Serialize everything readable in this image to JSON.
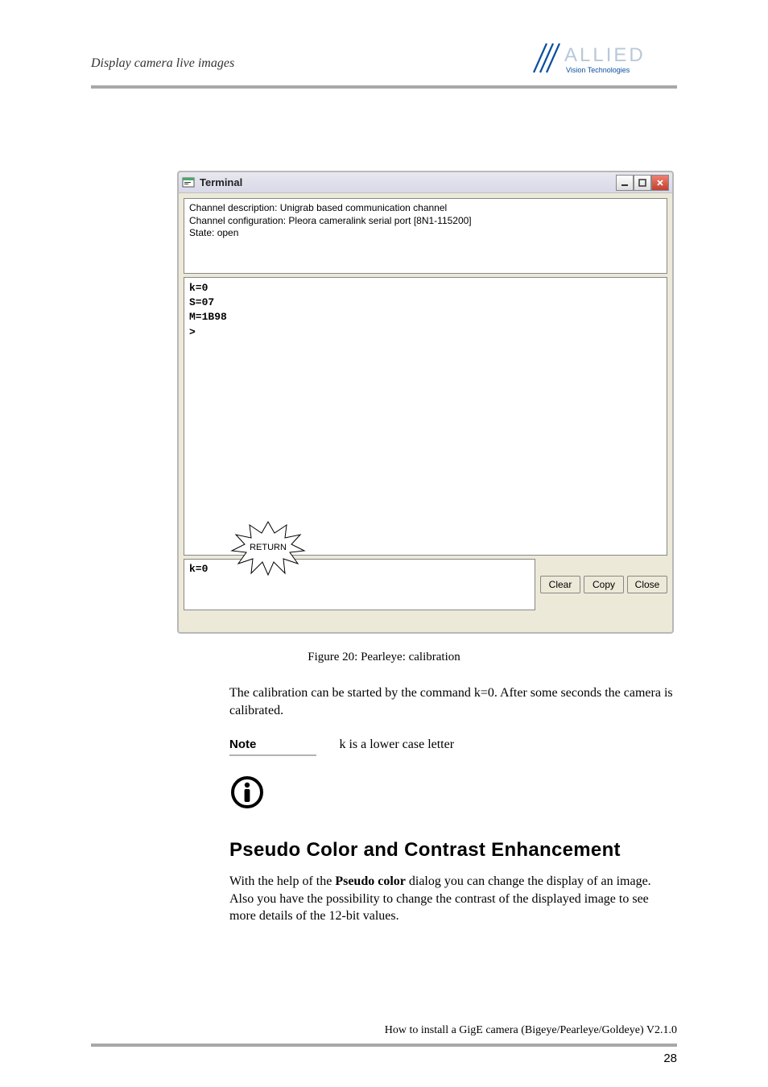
{
  "header": {
    "section_title": "Display camera live images",
    "logo_main": "ALLIED",
    "logo_sub": "Vision Technologies"
  },
  "window": {
    "title": "Terminal",
    "desc_line1": "Channel description: Unigrab based communication channel",
    "desc_line2": "Channel configuration: Pleora cameralink serial port [8N1-115200]",
    "desc_line3": "State: open",
    "output": "k=0\nS=07\nM=1B98\n>",
    "input_value": "k=0",
    "buttons": {
      "clear": "Clear",
      "copy": "Copy",
      "close": "Close"
    }
  },
  "annotation": {
    "return_label": "RETURN"
  },
  "figure_caption": "Figure 20: Pearleye: calibration",
  "paragraph1": "The calibration can be started by the command k=0. After some seconds the camera is calibrated.",
  "note_head": "Note",
  "note_text": "k is a lower case letter",
  "heading2": "Pseudo Color and Contrast Enhancement",
  "paragraph2_pre": "With the help of the ",
  "paragraph2_bold": "Pseudo color",
  "paragraph2_post": " dialog you can change the display of an image. Also you have the possibility to change the contrast of the displayed image to see more details of the 12-bit values.",
  "footer": {
    "line": "How to install a GigE camera (Bigeye/Pearleye/Goldeye) V2.1.0",
    "page": "28"
  }
}
